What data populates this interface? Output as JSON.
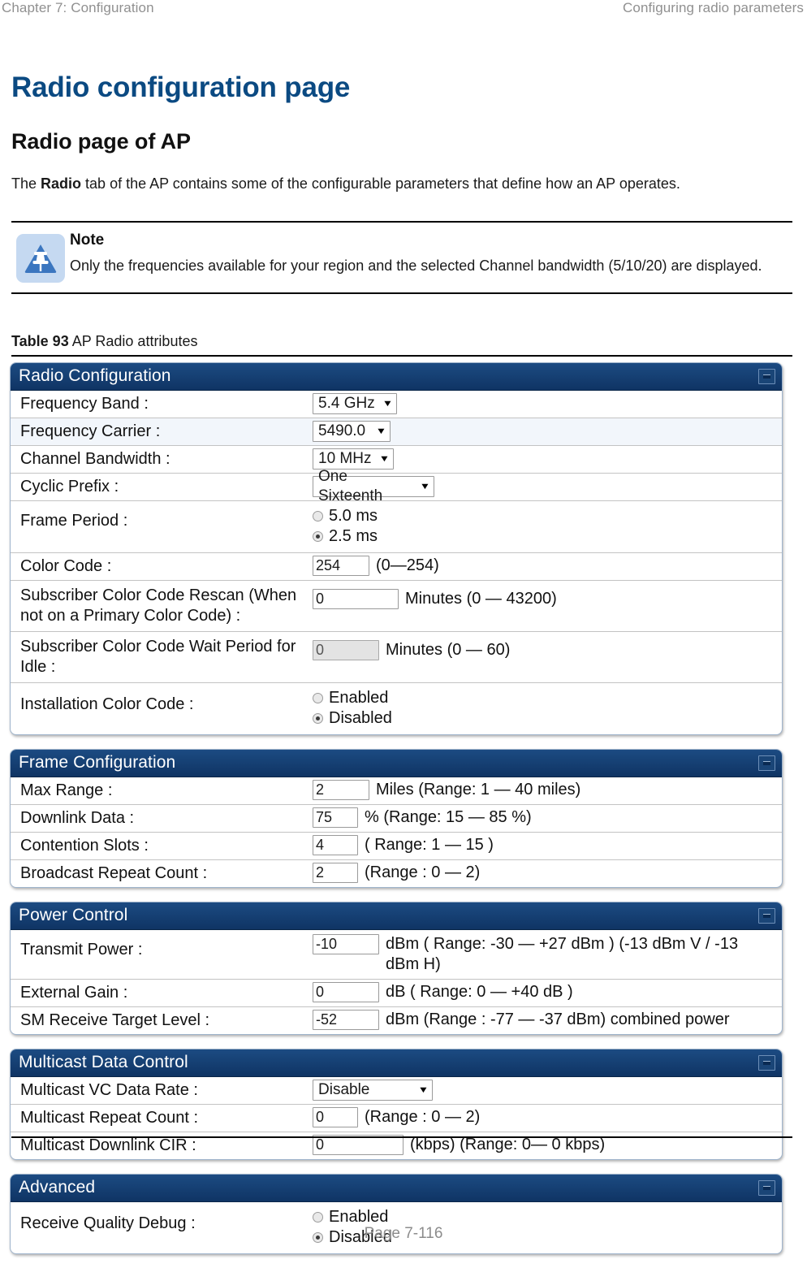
{
  "header": {
    "left": "Chapter 7:  Configuration",
    "right": "Configuring radio parameters"
  },
  "headings": {
    "h1": "Radio configuration page",
    "h2": "Radio page of AP"
  },
  "intro": {
    "before": "The ",
    "bold": "Radio",
    "after": " tab of the AP contains some of the configurable parameters that define how an AP operates."
  },
  "note": {
    "icon": "note-triangle-pushpin-icon",
    "title": "Note",
    "text": "Only the frequencies available for your region and the selected Channel bandwidth (5/10/20) are displayed."
  },
  "caption": {
    "bold": "Table 93",
    "rest": " AP Radio attributes"
  },
  "footer": {
    "page": "Page 7-116"
  },
  "panels": {
    "radio_configuration": {
      "title": "Radio Configuration",
      "rows": {
        "frequency_band": {
          "label": "Frequency Band :",
          "value": "5.4 GHz"
        },
        "frequency_carrier": {
          "label": "Frequency Carrier :",
          "value": "5490.0"
        },
        "channel_bandwidth": {
          "label": "Channel Bandwidth :",
          "value": "10 MHz"
        },
        "cyclic_prefix": {
          "label": "Cyclic Prefix :",
          "value": "One Sixteenth"
        },
        "frame_period": {
          "label": "Frame Period :",
          "option_1": "5.0 ms",
          "option_2": "2.5 ms",
          "selected": "2.5 ms"
        },
        "color_code": {
          "label": "Color Code :",
          "value": "254",
          "hint": "(0—254)"
        },
        "subscriber_rescan": {
          "label": "Subscriber Color Code Rescan (When not on a Primary Color Code) :",
          "value": "0",
          "hint": "Minutes (0 — 43200)"
        },
        "subscriber_wait": {
          "label": "Subscriber Color Code Wait Period for Idle :",
          "value": "0",
          "hint": "Minutes (0 — 60)",
          "disabled": true
        },
        "installation_color_code": {
          "label": "Installation Color Code :",
          "option_1": "Enabled",
          "option_2": "Disabled",
          "selected": "Disabled"
        }
      }
    },
    "frame_configuration": {
      "title": "Frame Configuration",
      "rows": {
        "max_range": {
          "label": "Max Range :",
          "value": "2",
          "hint": "Miles (Range: 1 — 40 miles)"
        },
        "downlink_data": {
          "label": "Downlink Data :",
          "value": "75",
          "hint": "% (Range: 15 — 85 %)"
        },
        "contention_slots": {
          "label": "Contention Slots :",
          "value": "4",
          "hint": "( Range: 1 — 15 )"
        },
        "broadcast_repeat_count": {
          "label": "Broadcast Repeat Count :",
          "value": "2",
          "hint": "(Range : 0 — 2)"
        }
      }
    },
    "power_control": {
      "title": "Power Control",
      "rows": {
        "transmit_power": {
          "label": "Transmit Power :",
          "value": "-10",
          "hint": "dBm ( Range: -30 — +27 dBm ) (-13 dBm V / -13 dBm H)"
        },
        "external_gain": {
          "label": "External Gain :",
          "value": "0",
          "hint": "dB ( Range: 0 — +40 dB )"
        },
        "sm_receive_target_level": {
          "label": "SM Receive Target Level :",
          "value": "-52",
          "hint": "dBm (Range : -77 — -37 dBm) combined power"
        }
      }
    },
    "multicast_data_control": {
      "title": "Multicast Data Control",
      "rows": {
        "multicast_vc_data_rate": {
          "label": "Multicast VC Data Rate :",
          "value": "Disable"
        },
        "multicast_repeat_count": {
          "label": "Multicast Repeat Count :",
          "value": "0",
          "hint": "(Range : 0 — 2)"
        },
        "multicast_downlink_cir": {
          "label": "Multicast Downlink CIR :",
          "value": "0",
          "hint": "(kbps) (Range: 0— 0 kbps)"
        }
      }
    },
    "advanced": {
      "title": "Advanced",
      "rows": {
        "receive_quality_debug": {
          "label": "Receive Quality Debug :",
          "option_1": "Enabled",
          "option_2": "Disabled",
          "selected": "Disabled"
        }
      }
    }
  },
  "icons": {
    "minimize": "minimize-icon",
    "caret": "▼"
  },
  "colors": {
    "heading_blue": "#0b4a82",
    "panel_header_blue": "#123c70",
    "note_bg": "#c5d9f1",
    "note_icon": "#3b76bf"
  }
}
